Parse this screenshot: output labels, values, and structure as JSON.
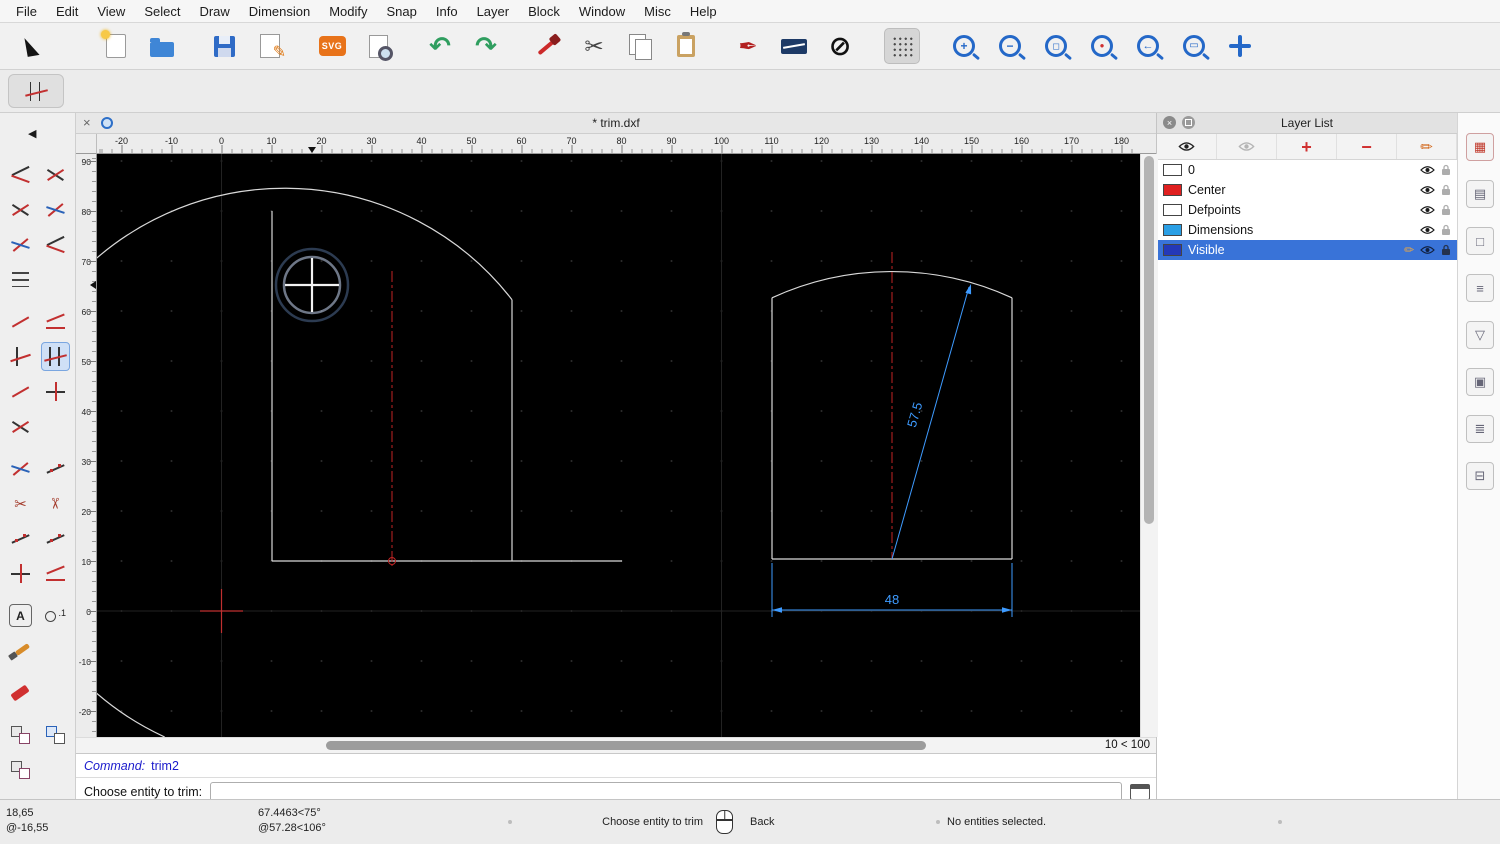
{
  "window": {
    "title": "* trim.dxf"
  },
  "menubar": {
    "items": [
      "File",
      "Edit",
      "View",
      "Select",
      "Draw",
      "Dimension",
      "Modify",
      "Snap",
      "Info",
      "Layer",
      "Block",
      "Window",
      "Misc",
      "Help"
    ]
  },
  "toolbar": {
    "svg_label": "SVG",
    "icons": [
      "pointer",
      "new-file",
      "open-file",
      "save",
      "save-as",
      "svg-export",
      "print-preview",
      "undo",
      "redo",
      "remove",
      "cut",
      "copy",
      "paste",
      "pen",
      "line-attributes",
      "draft-mode",
      "grid-toggle",
      "zoom-in",
      "zoom-out",
      "zoom-auto",
      "zoom-selection",
      "zoom-previous",
      "zoom-window",
      "pan"
    ],
    "active_icon": "grid-toggle"
  },
  "active_tool": {
    "name": "trim-both",
    "command": "trim2"
  },
  "tabbar": {
    "title": "* trim.dxf"
  },
  "rulers": {
    "horizontal": [
      "-20",
      "-10",
      "0",
      "10",
      "20",
      "30",
      "40",
      "50",
      "60",
      "70",
      "80",
      "90",
      "100",
      "110",
      "120",
      "130",
      "140",
      "150",
      "160",
      "170",
      "180"
    ],
    "vertical": [
      "90",
      "80",
      "70",
      "60",
      "50",
      "40",
      "30",
      "20",
      "10",
      "0",
      "-10",
      "-20"
    ]
  },
  "canvas": {
    "radius_dim": "57.5",
    "width_dim": "48",
    "grid_status": "10 < 100",
    "colors": {
      "background": "#000000",
      "geometry": "#d9d9d9",
      "centerline": "#c22525",
      "dimension": "#3e9bff"
    }
  },
  "layer_panel": {
    "title": "Layer List",
    "layers": [
      {
        "name": "0",
        "color": "#ffffff",
        "selected": false
      },
      {
        "name": "Center",
        "color": "#e02020",
        "selected": false
      },
      {
        "name": "Defpoints",
        "color": "#ffffff",
        "selected": false
      },
      {
        "name": "Dimensions",
        "color": "#2a9fe5",
        "selected": false
      },
      {
        "name": "Visible",
        "color": "#2438b8",
        "selected": true
      }
    ]
  },
  "command": {
    "history_label": "Command:",
    "history_value": "trim2",
    "prompt": "Choose entity to trim:",
    "input_value": ""
  },
  "statusbar": {
    "abs_cartesian": "18,65",
    "rel_cartesian": "@-16,55",
    "abs_polar": "67.4463<75°",
    "rel_polar": "@57.28<106°",
    "left_click_hint": "Choose entity to trim",
    "right_click_hint": "Back",
    "selection_status": "No entities selected."
  }
}
